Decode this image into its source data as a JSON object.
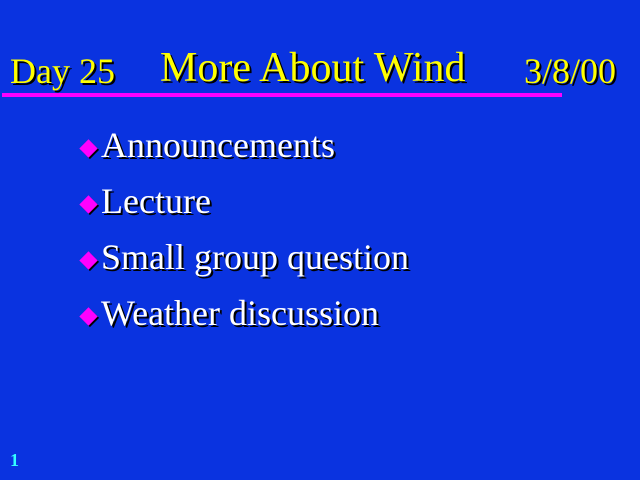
{
  "slide": {
    "title": {
      "day": "Day 25",
      "main": "More About Wind",
      "date": "3/8/00"
    },
    "bullets": [
      {
        "icon": "diamond-bullet-icon",
        "text": "Announcements"
      },
      {
        "icon": "diamond-bullet-icon",
        "text": "Lecture"
      },
      {
        "icon": "diamond-bullet-icon",
        "text": "Small group question"
      },
      {
        "icon": "diamond-bullet-icon",
        "text": "Weather discussion"
      }
    ],
    "slide_number": "1"
  },
  "colors": {
    "background": "#0a33e0",
    "title_text": "#ffff00",
    "title_rule": "#ff00ff",
    "bullet_icon": "#ff00ff",
    "bullet_text": "#ffffff",
    "slide_number": "#33ffff"
  }
}
